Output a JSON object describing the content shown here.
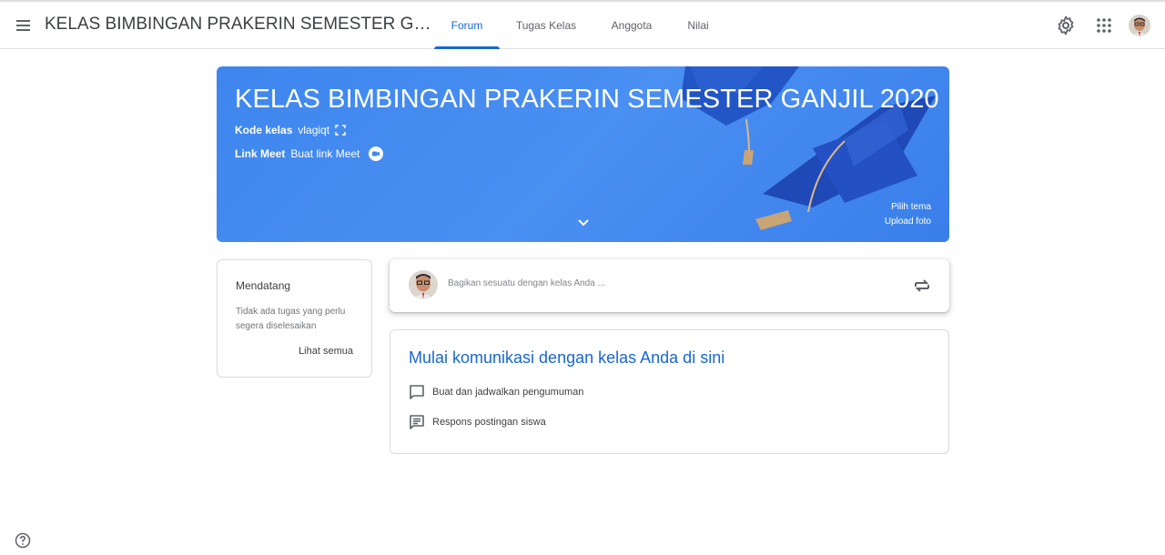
{
  "header": {
    "title": "KELAS BIMBINGAN PRAKERIN SEMESTER GANJIL 20...",
    "tabs": [
      {
        "label": "Forum",
        "active": true
      },
      {
        "label": "Tugas Kelas",
        "active": false
      },
      {
        "label": "Anggota",
        "active": false
      },
      {
        "label": "Nilai",
        "active": false
      }
    ],
    "icons": [
      "menu-icon",
      "gear-icon",
      "apps-grid-icon",
      "avatar"
    ]
  },
  "banner": {
    "title": "KELAS BIMBINGAN PRAKERIN SEMESTER GANJIL 2020",
    "code_label": "Kode kelas",
    "code_value": "vlagiqt",
    "meet_label": "Link Meet",
    "meet_value": "Buat link Meet",
    "theme_link": "Pilih tema",
    "upload_link": "Upload foto",
    "color": "#4285f4"
  },
  "upcoming": {
    "title": "Mendatang",
    "empty_text": "Tidak ada tugas yang perlu segera diselesaikan",
    "view_all": "Lihat semua"
  },
  "share": {
    "placeholder": "Bagikan sesuatu dengan kelas Anda ..."
  },
  "communication": {
    "title": "Mulai komunikasi dengan kelas Anda di sini",
    "items": [
      {
        "icon": "announcement-icon",
        "label": "Buat dan jadwalkan pengumuman"
      },
      {
        "icon": "comment-icon",
        "label": "Respons postingan siswa"
      }
    ],
    "accent": "#1967d2"
  }
}
